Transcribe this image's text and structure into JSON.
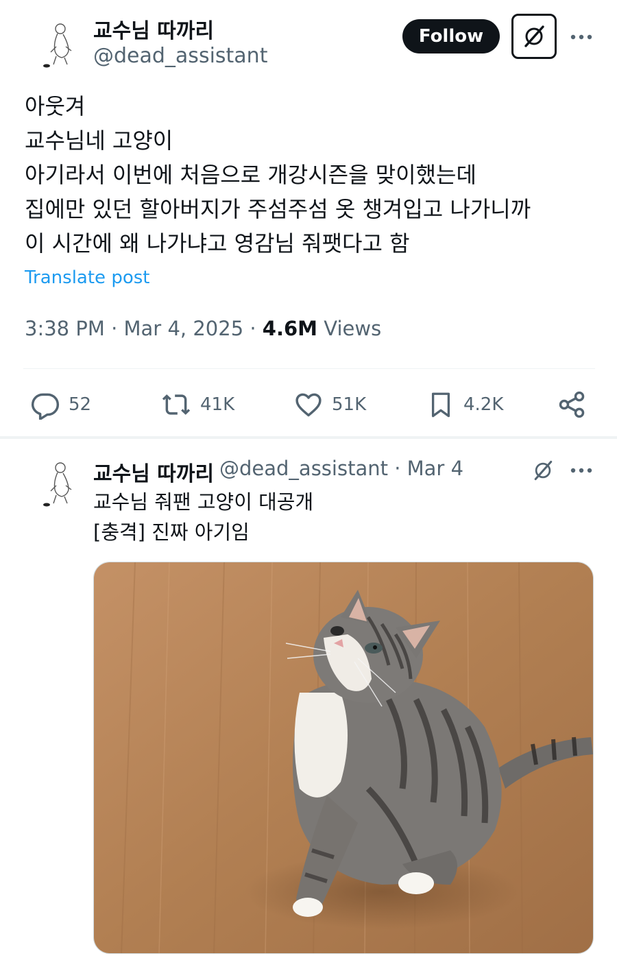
{
  "post": {
    "display_name": "교수님 따까리",
    "handle": "@dead_assistant",
    "follow_label": "Follow",
    "lines": [
      "아웃겨",
      "교수님네 고양이",
      "아기라서 이번에 처음으로 개강시즌을 맞이했는데",
      "집에만 있던 할아버지가 주섬주섬 옷 챙겨입고 나가니까",
      "이 시간에 왜 나가냐고 영감님 줘팻다고 함"
    ],
    "translate_label": "Translate post",
    "time": "3:38 PM",
    "date": "Mar 4, 2025",
    "separator": "·",
    "views_count": "4.6M",
    "views_label": "Views"
  },
  "actions": {
    "replies": "52",
    "reposts": "41K",
    "likes": "51K",
    "bookmarks": "4.2K"
  },
  "reply": {
    "display_name": "교수님 따까리",
    "handle_date": "@dead_assistant · Mar 4",
    "lines": [
      "교수님 줘팬 고양이 대공개",
      "[충격] 진짜 아기임"
    ]
  },
  "icons": {
    "more": "more-horizontal-icon",
    "grok": "grok-icon",
    "reply": "reply-icon",
    "repost": "repost-icon",
    "like": "heart-icon",
    "bookmark": "bookmark-icon",
    "share": "share-icon"
  },
  "colors": {
    "text": "#0f1419",
    "secondary": "#536471",
    "link": "#1d9bf0",
    "divider": "#eff3f4",
    "floor": "#b17f52"
  }
}
